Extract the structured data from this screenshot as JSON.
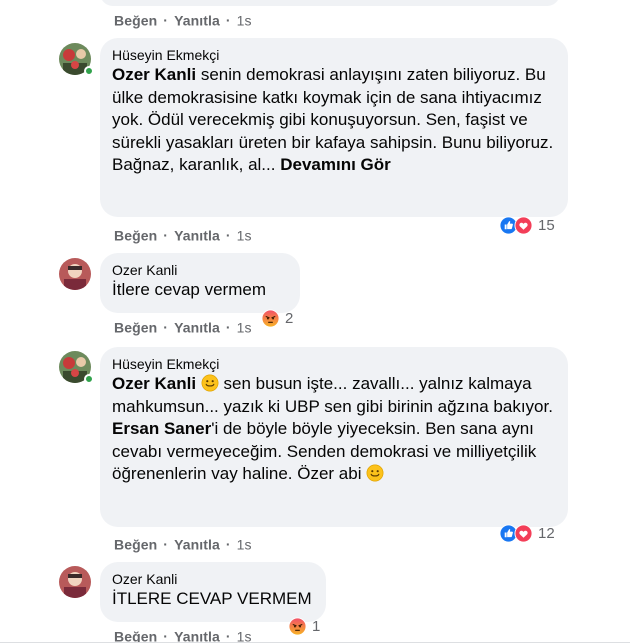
{
  "actions": {
    "like": "Beğen",
    "reply": "Yanıtla",
    "sep": "·"
  },
  "header_actions": {
    "time": "1s"
  },
  "comments": [
    {
      "author": "Hüseyin Ekmekçi",
      "mention": "Ozer Kanli",
      "text_after_mention": " senin demokrasi anlayışını zaten biliyoruz. Bu ülke demokrasisine katkı koymak için de sana ihtiyacımız yok. Ödül verecekmiş gibi konuşuyorsun. Sen, faşist ve sürekli yasakları üreten bir kafaya sahipsin. Bunu biliyoruz. Bağnaz, karanlık, al...",
      "see_more": "Devamını Gör",
      "reaction_count": "15",
      "reaction_icons": [
        "like-icon",
        "love-icon"
      ],
      "time": "1s",
      "online": true
    },
    {
      "author": "Ozer Kanli",
      "text": "İtlere cevap vermem",
      "reaction_count": "2",
      "reaction_icons": [
        "angry-icon"
      ],
      "time": "1s",
      "online": false
    },
    {
      "author": "Hüseyin Ekmekçi",
      "mention": "Ozer Kanli",
      "mention2": "Ersan Saner",
      "text_a": " sen busun işte... zavallı... yalnız kalmaya mahkumsun... yazık ki UBP sen gibi birinin ağzına bakıyor. ",
      "text_b": "'i de böyle böyle yiyeceksin. Ben sana aynı cevabı vermeyeceğim. Senden demokrasi ve milliyetçilik öğrenenlerin vay haline. Özer abi ",
      "reaction_count": "12",
      "reaction_icons": [
        "like-icon",
        "love-icon"
      ],
      "time": "1s",
      "online": true
    },
    {
      "author": "Ozer Kanli",
      "text": "İTLERE CEVAP VERMEM",
      "reaction_count": "1",
      "reaction_icons": [
        "angry-icon"
      ],
      "time": "1s",
      "online": false
    }
  ],
  "colors": {
    "bubble": "#f0f2f5",
    "meta": "#65676b",
    "like": "#1877f2",
    "love": "#f33e58",
    "angry": "#e9710f",
    "online": "#31a24c"
  }
}
